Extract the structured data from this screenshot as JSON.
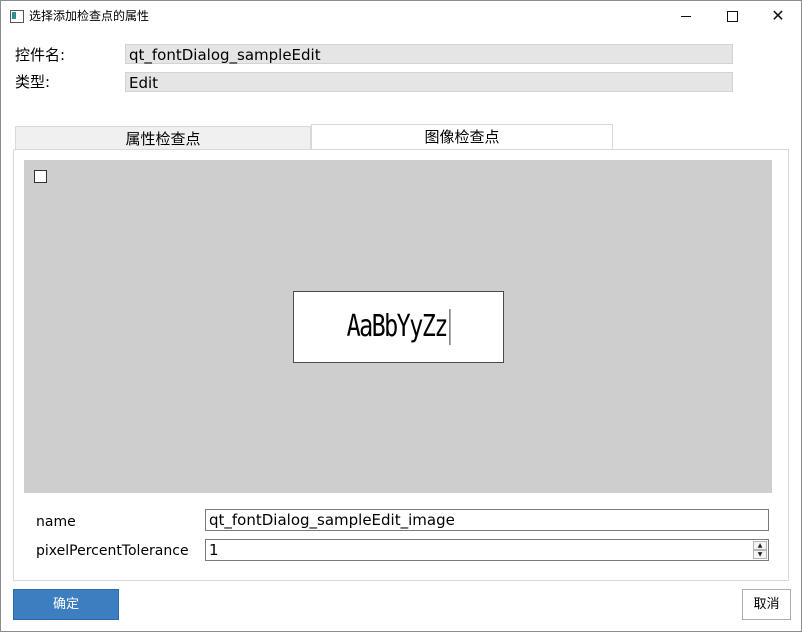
{
  "window": {
    "title": "选择添加检查点的属性",
    "minimize_icon": "minimize-icon",
    "maximize_icon": "maximize-icon",
    "close_icon": "close-icon",
    "close_glyph": "✕"
  },
  "control": {
    "name_label": "控件名:",
    "name_value": "qt_fontDialog_sampleEdit",
    "type_label": "类型:",
    "type_value": "Edit"
  },
  "tabs": [
    {
      "label": "属性检查点",
      "active": false
    },
    {
      "label": "图像检查点",
      "active": true
    }
  ],
  "image_checkpoint": {
    "checkbox_checked": false,
    "sample_text": "AaBbYyZz"
  },
  "properties": [
    {
      "label": "name",
      "value": "qt_fontDialog_sampleEdit_image"
    },
    {
      "label": "pixelPercentTolerance",
      "value": "1"
    }
  ],
  "spin": {
    "up": "▲",
    "down": "▼"
  },
  "buttons": {
    "ok": "确定",
    "cancel": "取消"
  },
  "colors": {
    "primary_button": "#3c7ec0",
    "image_area_bg": "#cecece"
  }
}
